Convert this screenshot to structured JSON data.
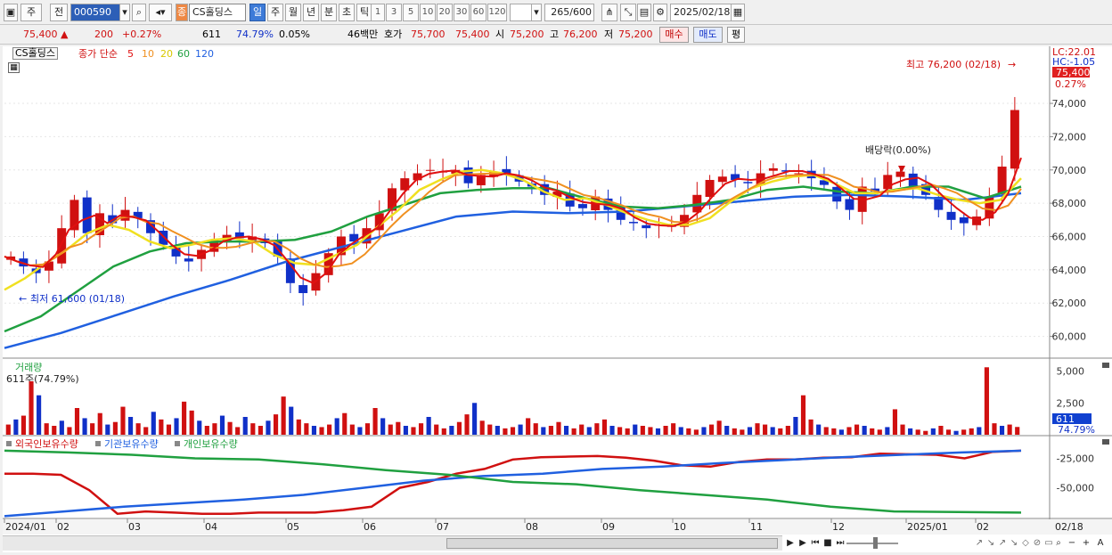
{
  "toolbar": {
    "period_mode": "주",
    "prev_label": "전",
    "code": "000590",
    "stock_name": "CS홀딩스",
    "stock_tag": "종",
    "period_tabs": [
      "일",
      "주",
      "월",
      "년",
      "분",
      "초",
      "틱"
    ],
    "active_period": "일",
    "intervals": [
      "1",
      "3",
      "5",
      "10",
      "20",
      "30",
      "60",
      "120"
    ],
    "count_label": "265",
    "count_total": "/600",
    "date": "2025/02/18"
  },
  "quote": {
    "price": "75,400",
    "change": "200",
    "change_pct": "+0.27%",
    "volume": "611",
    "volume_ratio": "74.79%",
    "turnover": "0.05%",
    "amount": "46백만",
    "ask_label": "호가",
    "ask_price": "75,700",
    "bid_price": "75,400",
    "open_label": "시",
    "open": "75,200",
    "high_label": "고",
    "high": "76,200",
    "low_label": "저",
    "low": "75,200",
    "buy_label": "매수",
    "sell_label": "매도",
    "eval_label": "평"
  },
  "colors": {
    "up": "#d01010",
    "down": "#1030c8",
    "ma5": "#e01010",
    "ma10": "#f09020",
    "ma20": "#f0e020",
    "ma60": "#20a040",
    "ma120": "#2060e0",
    "foreign": "#d01010",
    "institution": "#2060e0",
    "individual": "#20a040"
  },
  "chart_data": [
    {
      "type": "candlestick",
      "name_label": "CS홀딩스",
      "ma_labels": {
        "prefix": "종가 단순",
        "periods": [
          "5",
          "10",
          "20",
          "60",
          "120"
        ]
      },
      "y_ticks": [
        "74,000",
        "72,000",
        "70,000",
        "68,000",
        "66,000",
        "64,000",
        "62,000",
        "60,000"
      ],
      "ylim": [
        58800,
        77000
      ],
      "lc_label": "LC:22.01",
      "hc_label": "HC:-1.05",
      "current_price": "75,400",
      "current_pct": "0.27%",
      "annotations": {
        "max_label": "최고 76,200 (02/18)",
        "min_label": "최저 61,600 (01/18)",
        "dividend_label": "배당락(0.00%)"
      },
      "close_path": [
        64800,
        64200,
        63800,
        64500,
        66500,
        68200,
        66200,
        67400,
        66800,
        67600,
        67100,
        66200,
        65500,
        64800,
        64500,
        65200,
        65800,
        66100,
        65900,
        66000,
        65600,
        64800,
        63200,
        62600,
        63800,
        65000,
        66000,
        65700,
        66500,
        67400,
        68900,
        69500,
        69800,
        70000,
        69900,
        70000,
        69200,
        69700,
        69900,
        69800,
        69300,
        69000,
        68500,
        68700,
        67800,
        67700,
        68400,
        67600,
        67000,
        66800,
        66500,
        66700,
        66700,
        67300,
        68500,
        69400,
        69600,
        69400,
        69200,
        69800,
        70100,
        69900,
        69800,
        69500,
        69100,
        68100,
        67600,
        69000,
        68700,
        69700,
        69900,
        69000,
        68500,
        67600,
        67000,
        66800,
        67200,
        68400,
        70200,
        73600
      ],
      "ma20_path": [
        62800,
        63500,
        64400,
        65200,
        66200,
        66700,
        66400,
        65700,
        65300,
        65500,
        65800,
        65900,
        65700,
        64900,
        64400,
        64300,
        64900,
        65500,
        66600,
        67600,
        68800,
        69400,
        69900,
        70000,
        69800,
        69400,
        68700,
        68200,
        68300,
        67900,
        67400,
        67000,
        66700,
        66700,
        67100,
        68100,
        68900,
        69300,
        69600,
        69700,
        69200,
        68600,
        68600,
        68800,
        68900,
        68500,
        68200,
        68000,
        68200,
        69500
      ],
      "ma60_path": [
        60300,
        61200,
        62700,
        64200,
        65100,
        65600,
        65700,
        65700,
        65800,
        66300,
        67200,
        67900,
        68600,
        68800,
        68900,
        68900,
        68300,
        67800,
        67700,
        67900,
        68200,
        68800,
        69000,
        68700,
        68600,
        69000,
        69000,
        68300,
        69000
      ],
      "ma120_path": [
        59300,
        60200,
        61300,
        62400,
        63400,
        64500,
        65400,
        66300,
        67200,
        67500,
        67400,
        67500,
        67800,
        68100,
        68400,
        68500,
        68400,
        68200,
        68600
      ]
    },
    {
      "type": "bar",
      "title": "거래량",
      "summary": "611주(74.79%)",
      "y_ticks": [
        "5,000",
        "2,500"
      ],
      "current_value": "611",
      "current_pct": "74.79%",
      "ylim": [
        0,
        5600
      ],
      "values": [
        800,
        1200,
        1500,
        4200,
        3100,
        900,
        700,
        1100,
        600,
        2100,
        1300,
        900,
        1700,
        800,
        1000,
        2200,
        1400,
        900,
        600,
        1800,
        1200,
        800,
        1300,
        2600,
        1900,
        1100,
        700,
        900,
        1500,
        1000,
        600,
        1400,
        900,
        700,
        1100,
        1600,
        3000,
        2200,
        1200,
        900,
        700,
        600,
        800,
        1300,
        1700,
        800,
        600,
        900,
        2100,
        1300,
        800,
        1000,
        700,
        600,
        900,
        1400,
        800,
        500,
        700,
        1000,
        1600,
        2500,
        1100,
        800,
        700,
        500,
        600,
        800,
        1300,
        900,
        600,
        700,
        1000,
        700,
        500,
        800,
        600,
        900,
        1200,
        700,
        600,
        500,
        800,
        700,
        600,
        500,
        700,
        900,
        600,
        500,
        400,
        600,
        800,
        1100,
        700,
        500,
        400,
        600,
        900,
        800,
        600,
        500,
        700,
        1400,
        3100,
        1200,
        800,
        600,
        500,
        400,
        600,
        800,
        700,
        500,
        400,
        600,
        2000,
        800,
        500,
        400,
        300,
        500,
        700,
        400,
        300,
        400,
        500,
        600,
        5300,
        900,
        700,
        800,
        611
      ]
    },
    {
      "type": "line",
      "legend": [
        "외국인보유수량",
        "기관보유수량",
        "개인보유수량"
      ],
      "y_ticks": [
        "-25,000",
        "-50,000"
      ],
      "ylim": [
        -76000,
        -8000
      ],
      "x_labels": [
        "2024/01",
        "02",
        "03",
        "04",
        "05",
        "06",
        "07",
        "08",
        "09",
        "10",
        "11",
        "12",
        "2025/01",
        "02"
      ],
      "x_current": "02/18",
      "series": [
        {
          "name": "외국인보유수량",
          "values": [
            -38000,
            -38000,
            -39000,
            -52000,
            -72000,
            -70000,
            -71000,
            -72000,
            -72000,
            -71000,
            -71000,
            -71000,
            -69000,
            -66000,
            -50000,
            -45000,
            -38000,
            -34000,
            -26000,
            -24000,
            -23500,
            -23000,
            -24500,
            -27000,
            -31000,
            -32000,
            -28000,
            -26000,
            -26000,
            -24500,
            -24000,
            -21000,
            -21500,
            -22000,
            -25000,
            -19500,
            -18500
          ]
        },
        {
          "name": "기관보유수량",
          "values": [
            -74000,
            -70000,
            -66000,
            -63000,
            -60000,
            -56000,
            -50000,
            -44000,
            -40000,
            -38000,
            -34000,
            -32000,
            -29000,
            -26500,
            -24000,
            -22000,
            -20000,
            -18500
          ]
        },
        {
          "name": "개인보유수량",
          "values": [
            -18500,
            -20000,
            -22000,
            -25000,
            -26000,
            -30000,
            -35000,
            -39000,
            -45000,
            -47000,
            -52000,
            -56000,
            -60000,
            -66000,
            -70000,
            -70500,
            -71000
          ]
        }
      ]
    }
  ],
  "bottom": {
    "scroll_left": "◀",
    "scroll_right": "▶",
    "play_controls": [
      "▶",
      "⏮",
      "■",
      "⏭"
    ],
    "zoom_controls": [
      "−",
      "+",
      "A"
    ]
  }
}
